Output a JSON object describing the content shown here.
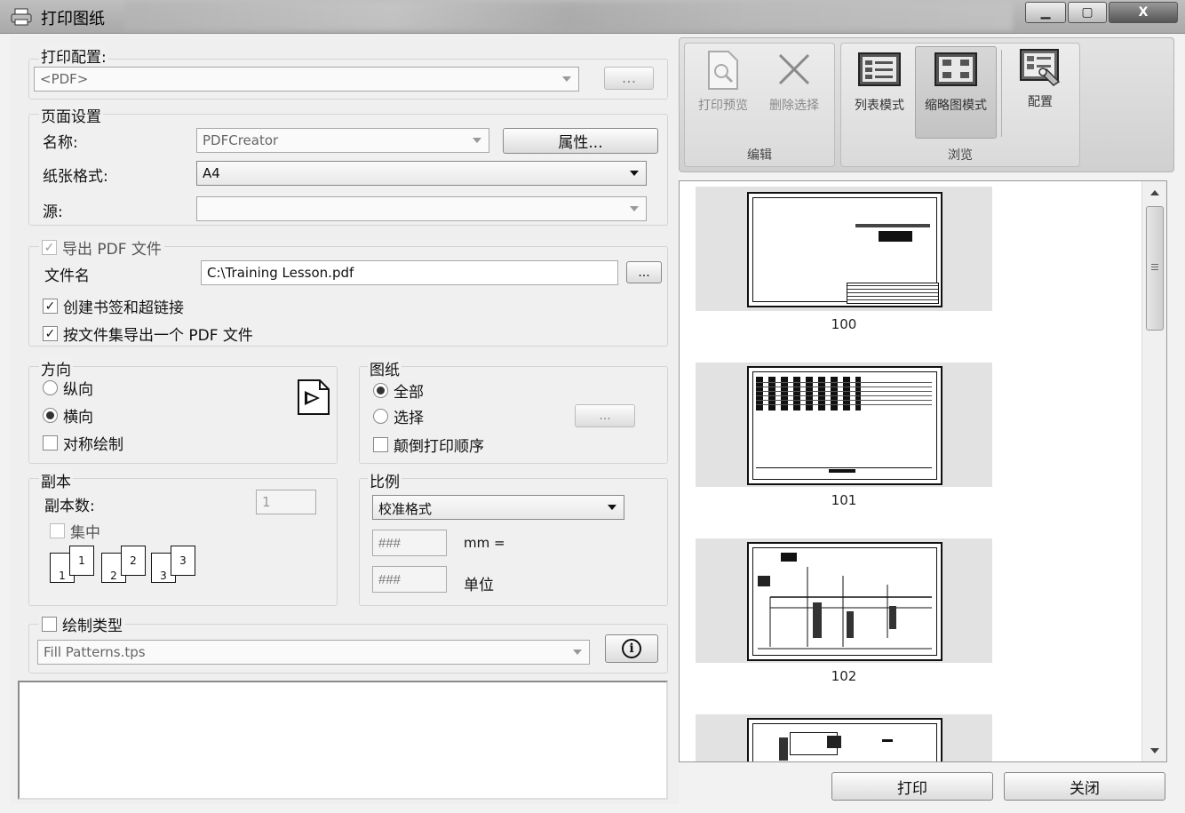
{
  "window": {
    "title": "打印图纸",
    "minimize": "▁",
    "maximize": "▢",
    "close": "X"
  },
  "print_config": {
    "legend": "打印配置:",
    "value": "<PDF>",
    "more_label": "..."
  },
  "page_setup": {
    "legend": "页面设置",
    "name_label": "名称:",
    "name_value": "PDFCreator",
    "properties_label": "属性...",
    "paper_label": "纸张格式:",
    "paper_value": "A4",
    "source_label": "源:",
    "source_value": ""
  },
  "export_pdf": {
    "label": "导出 PDF 文件",
    "checked": true,
    "filename_label": "文件名",
    "filename_value": "C:\\Training Lesson.pdf",
    "browse_label": "...",
    "bookmarks_label": "创建书签和超链接",
    "bookmarks_checked": true,
    "single_pdf_label": "按文件集导出一个 PDF 文件",
    "single_pdf_checked": true
  },
  "orientation": {
    "legend": "方向",
    "portrait": "纵向",
    "landscape": "横向",
    "selected": "landscape",
    "symmetric_label": "对称绘制",
    "symmetric_checked": false
  },
  "sheets": {
    "legend": "图纸",
    "all": "全部",
    "select": "选择",
    "selected": "all",
    "more_label": "...",
    "reverse_label": "颠倒打印顺序",
    "reverse_checked": false
  },
  "copies": {
    "legend": "副本",
    "count_label": "副本数:",
    "count_value": "1",
    "collate_label": "集中",
    "collate_checked": false,
    "collate_icons": [
      "1",
      "1",
      "2",
      "2",
      "3",
      "3"
    ]
  },
  "scale": {
    "legend": "比例",
    "value": "校准格式",
    "field1_placeholder": "###",
    "field1_unit": "mm =",
    "field2_placeholder": "###",
    "field2_unit": "单位"
  },
  "draw_type": {
    "label": "绘制类型",
    "checked": false,
    "value": "Fill Patterns.tps",
    "info_label": "i"
  },
  "ribbon": {
    "edit_group": "编辑",
    "browse_group": "浏览",
    "preview_label": "打印预览",
    "delete_label": "删除选择",
    "list_mode_label": "列表模式",
    "thumb_mode_label": "缩略图模式",
    "config_label": "配置"
  },
  "thumbnails": [
    {
      "label": "100"
    },
    {
      "label": "101"
    },
    {
      "label": "102"
    },
    {
      "label": ""
    }
  ],
  "buttons": {
    "print": "打印",
    "close": "关闭"
  }
}
